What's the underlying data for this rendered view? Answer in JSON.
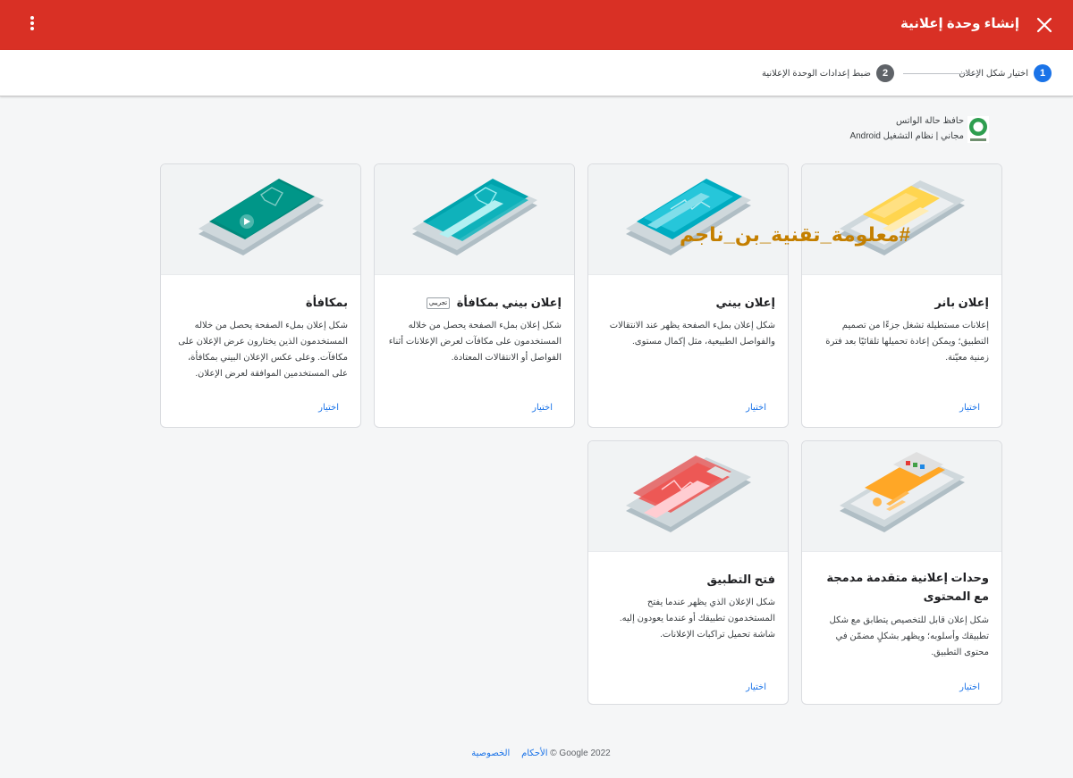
{
  "header": {
    "title": "إنشاء وحدة إعلانية",
    "close_icon": "close-icon",
    "menu_icon": "more-vert-icon"
  },
  "stepper": {
    "steps": [
      {
        "num": "1",
        "label": "اختيار شكل الإعلان",
        "active": true
      },
      {
        "num": "2",
        "label": "ضبط إعدادات الوحدة الإعلانية",
        "active": false
      }
    ]
  },
  "app": {
    "name": "حافظ حالة الواتس",
    "meta": "مجاني | نظام التشغيل Android"
  },
  "cards": [
    {
      "title": "إعلان بانر",
      "desc": "إعلانات مستطيلة تشغل جزءًا من تصميم التطبيق؛ ويمكن إعادة تحميلها تلقائيًا بعد فترة زمنية معيّنة.",
      "select": "اختيار"
    },
    {
      "title": "إعلان بيني",
      "desc": "شكل إعلان بملء الصفحة يظهر عند الانتقالات والفواصل الطبيعية، مثل إكمال مستوى.",
      "select": "اختيار"
    },
    {
      "title": "إعلان بيني بمكافأة",
      "badge": "تجريبي",
      "desc": "شكل إعلان بملء الصفحة يحصل من خلاله المستخدمون على مكافآت لعرض الإعلانات أثناء الفواصل أو الانتقالات المعتادة.",
      "select": "اختيار"
    },
    {
      "title": "بمكافأة",
      "desc": "شكل إعلان بملء الصفحة يحصل من خلاله المستخدمون الذين يختارون عرض الإعلان على مكافآت. وعلى عكس الإعلان البيني بمكافأة، على المستخدمين الموافقة لعرض الإعلان.",
      "select": "اختيار"
    },
    {
      "title": "وحدات إعلانية متقدمة مدمجة مع المحتوى",
      "desc": "شكل إعلان قابل للتخصيص يتطابق مع شكل تطبيقك وأسلوبه؛ ويظهر بشكلٍ مضمّن في محتوى التطبيق.",
      "select": "اختيار"
    },
    {
      "title": "فتح التطبيق",
      "desc": "شكل الإعلان الذي يظهر عندما يفتح المستخدمون تطبيقك أو عندما يعودون إليه. شاشة تحميل تراكبات الإعلانات.",
      "select": "اختيار"
    }
  ],
  "watermark": "#معلومة_تقنية_بن_ناجم",
  "footer": {
    "copyright": "© Google 2022",
    "privacy": "الخصوصية",
    "terms": "الأحكام"
  },
  "colors": {
    "header": "#d93025",
    "accent": "#1a73e8",
    "step_inactive": "#5f6368"
  }
}
